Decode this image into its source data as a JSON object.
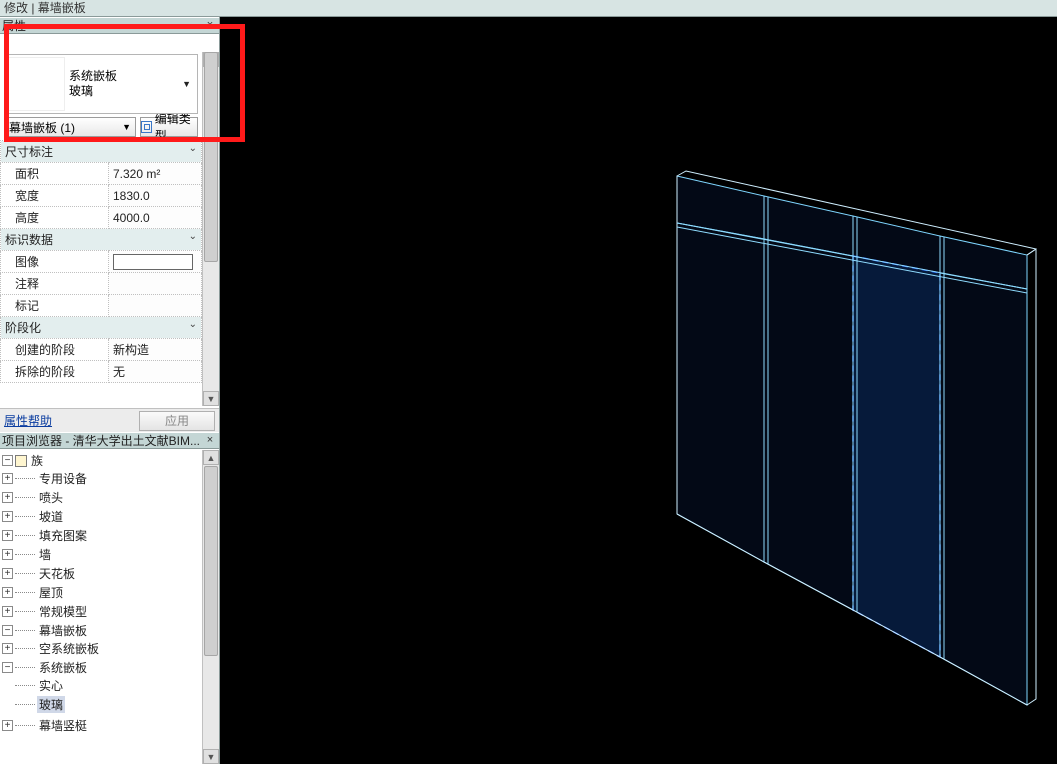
{
  "top_title": "修改 | 幕墙嵌板",
  "properties": {
    "panel_title": "属性",
    "type_line1": "系统嵌板",
    "type_line2": "玻璃",
    "instance_label": "幕墙嵌板 (1)",
    "edit_type_label": "编辑类型",
    "groups": {
      "dimensions_truncated": "尺寸标注",
      "identity": "标识数据",
      "phasing": "阶段化"
    },
    "rows": {
      "area_label": "面积",
      "area_value": "7.320 m²",
      "width_label": "宽度",
      "width_value": "1830.0",
      "height_label": "高度",
      "height_value": "4000.0",
      "image_label": "图像",
      "image_value": "",
      "comments_label": "注释",
      "comments_value": "",
      "mark_label": "标记",
      "mark_value": "",
      "phase_created_label": "创建的阶段",
      "phase_created_value": "新构造",
      "phase_demolished_label": "拆除的阶段",
      "phase_demolished_value": "无"
    },
    "help_link": "属性帮助",
    "apply_label": "应用"
  },
  "browser": {
    "panel_title": "项目浏览器 - 清华大学出土文献BIM...",
    "root": "族",
    "items": [
      "专用设备",
      "喷头",
      "坡道",
      "填充图案",
      "墙",
      "天花板",
      "屋顶",
      "常规模型",
      "幕墙嵌板"
    ],
    "sub_panels": {
      "empty": "空系统嵌板",
      "system": "系统嵌板"
    },
    "system_children": {
      "solid": "实心",
      "glass": "玻璃"
    },
    "last": "幕墙竖梃"
  }
}
